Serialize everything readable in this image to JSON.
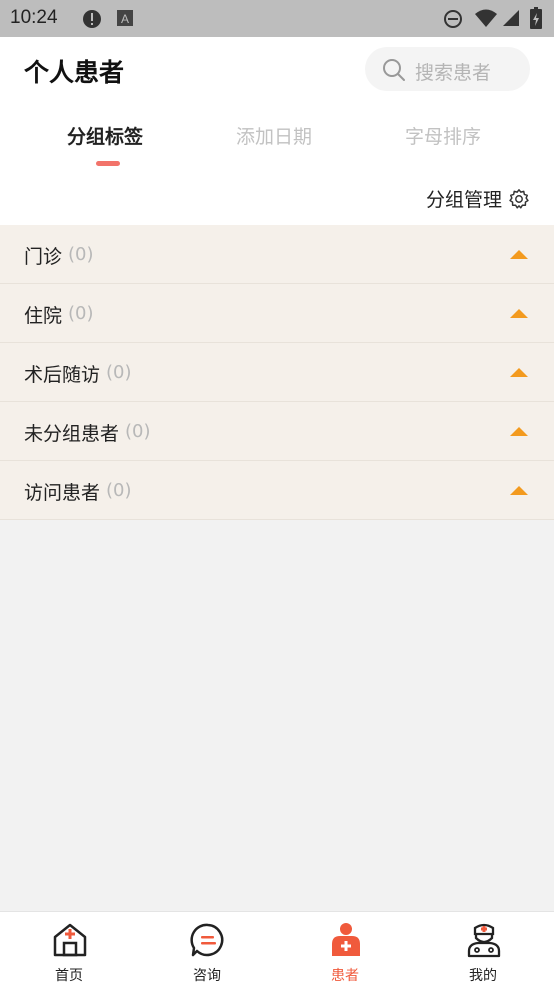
{
  "status_bar": {
    "time": "10:24"
  },
  "header": {
    "title": "个人患者",
    "search_placeholder": "搜索患者",
    "tabs": [
      {
        "label": "分组标签",
        "active": true
      },
      {
        "label": "添加日期",
        "active": false
      },
      {
        "label": "字母排序",
        "active": false
      }
    ],
    "manage_label": "分组管理"
  },
  "groups": [
    {
      "name": "门诊",
      "count": "(0)"
    },
    {
      "name": "住院",
      "count": "(0)"
    },
    {
      "name": "术后随访",
      "count": "(0)"
    },
    {
      "name": "未分组患者",
      "count": "(0)"
    },
    {
      "name": "访问患者",
      "count": "(0)"
    }
  ],
  "tabbar": [
    {
      "label": "首页",
      "icon": "home-hospital-icon"
    },
    {
      "label": "咨询",
      "icon": "chat-icon"
    },
    {
      "label": "患者",
      "icon": "patient-icon",
      "active": true
    },
    {
      "label": "我的",
      "icon": "doctor-icon"
    }
  ],
  "colors": {
    "accent": "#f05a3c",
    "indicator": "#f2736a",
    "arrow": "#f39a1e"
  }
}
